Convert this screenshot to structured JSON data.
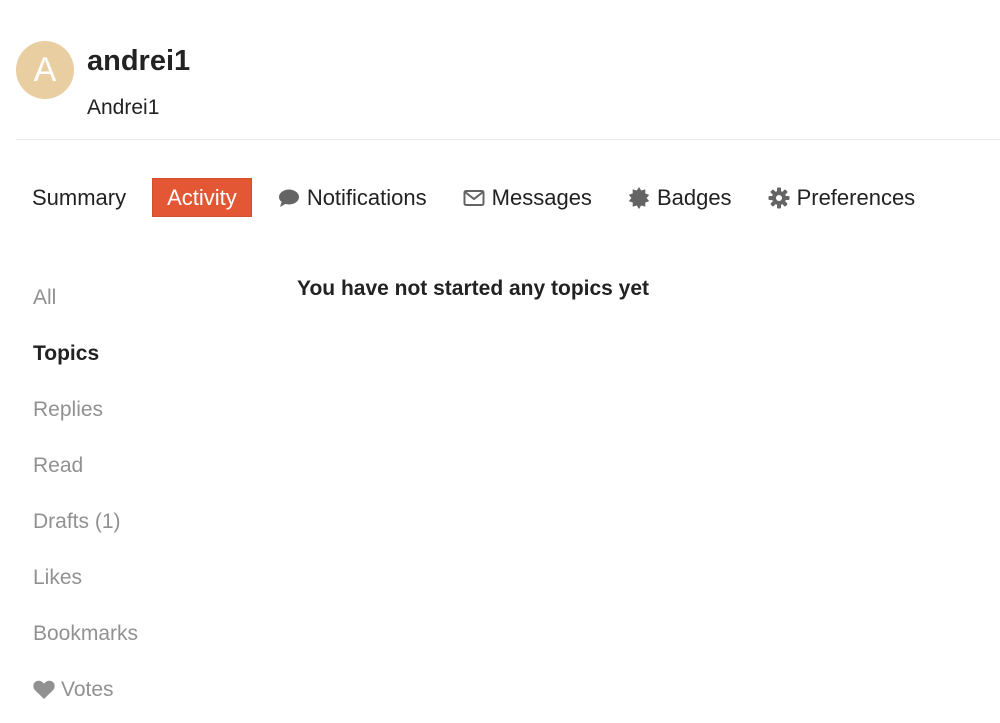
{
  "user": {
    "avatar_letter": "A",
    "avatar_color": "#e8ceA0",
    "username": "andrei1",
    "full_name": "Andrei1"
  },
  "theme": {
    "accent": "#e45735",
    "muted_text": "#919191",
    "icon_color": "#646464"
  },
  "nav": {
    "tabs": [
      {
        "label": "Summary",
        "icon": null,
        "active": false
      },
      {
        "label": "Activity",
        "icon": null,
        "active": true
      },
      {
        "label": "Notifications",
        "icon": "comment-icon",
        "active": false
      },
      {
        "label": "Messages",
        "icon": "envelope-icon",
        "active": false
      },
      {
        "label": "Badges",
        "icon": "badge-icon",
        "active": false
      },
      {
        "label": "Preferences",
        "icon": "gear-icon",
        "active": false
      }
    ]
  },
  "sidebar": {
    "items": [
      {
        "label": "All",
        "active": false
      },
      {
        "label": "Topics",
        "active": true
      },
      {
        "label": "Replies",
        "active": false
      },
      {
        "label": "Read",
        "active": false
      },
      {
        "label": "Drafts (1)",
        "active": false
      },
      {
        "label": "Likes",
        "active": false
      },
      {
        "label": "Bookmarks",
        "active": false
      },
      {
        "label": "Votes",
        "icon": "heart-icon",
        "active": false
      }
    ]
  },
  "main": {
    "empty_message": "You have not started any topics yet"
  }
}
